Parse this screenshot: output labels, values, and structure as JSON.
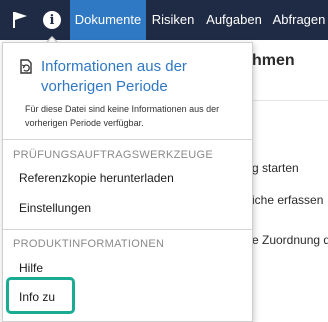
{
  "nav": {
    "flag_icon": "flag-icon",
    "info_icon": "info-icon",
    "info_glyph": "i",
    "tabs": [
      {
        "label": "Dokumente",
        "active": true
      },
      {
        "label": "Risiken",
        "active": false
      },
      {
        "label": "Aufgaben",
        "active": false
      },
      {
        "label": "Abfragen",
        "active": false
      }
    ]
  },
  "background": {
    "title_fragment": "hmen",
    "lines": [
      "g starten",
      "iche erfassen",
      "e Zuordnung de"
    ]
  },
  "menu": {
    "header_icon": "refresh-document-icon",
    "header_title": "Informationen aus der vorherigen Periode",
    "header_desc": "Für diese Datei sind keine Informationen aus der vorherigen Periode verfügbar.",
    "section_tools": "PRÜFUNGSAUFTRAGSWERKZEUGE",
    "tools_items": [
      "Referenzkopie herunterladen",
      "Einstellungen"
    ],
    "section_product": "PRODUKTINFORMATIONEN",
    "product_items": [
      "Hilfe",
      "Info zu"
    ]
  },
  "colors": {
    "topbar": "#1f2a44",
    "active_tab": "#2f78c4",
    "header_title": "#2f78c4",
    "highlight": "#1aab93"
  }
}
